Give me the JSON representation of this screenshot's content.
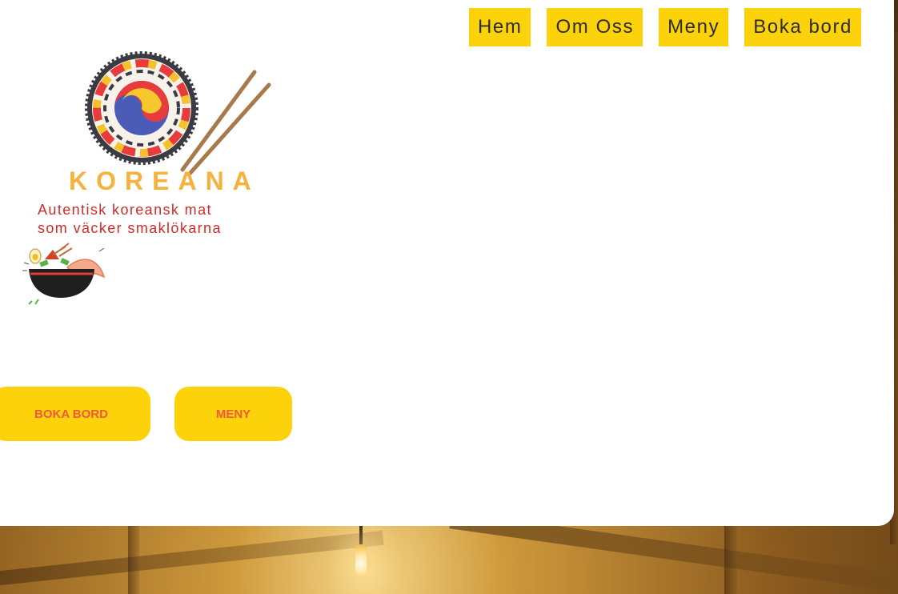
{
  "nav": {
    "items": [
      {
        "label": "Hem"
      },
      {
        "label": "Om Oss"
      },
      {
        "label": "Meny"
      },
      {
        "label": "Boka bord"
      }
    ]
  },
  "logo": {
    "name": "KOREANA",
    "tagline_line1": "Autentisk koreansk mat",
    "tagline_line2": "som väcker smaklökarna"
  },
  "cta": {
    "book_label": "BOKA BORD",
    "menu_label": "MENY"
  },
  "colors": {
    "accent_yellow": "#fcd20a",
    "logo_orange": "#f5b23c",
    "tagline_red": "#d02b2b",
    "cta_text": "#ec5a3c",
    "nav_text": "#2d2d2d"
  },
  "icons": {
    "logo_emblem": "taegeuk-chopsticks-icon",
    "food_bowl": "noodle-bowl-icon"
  }
}
